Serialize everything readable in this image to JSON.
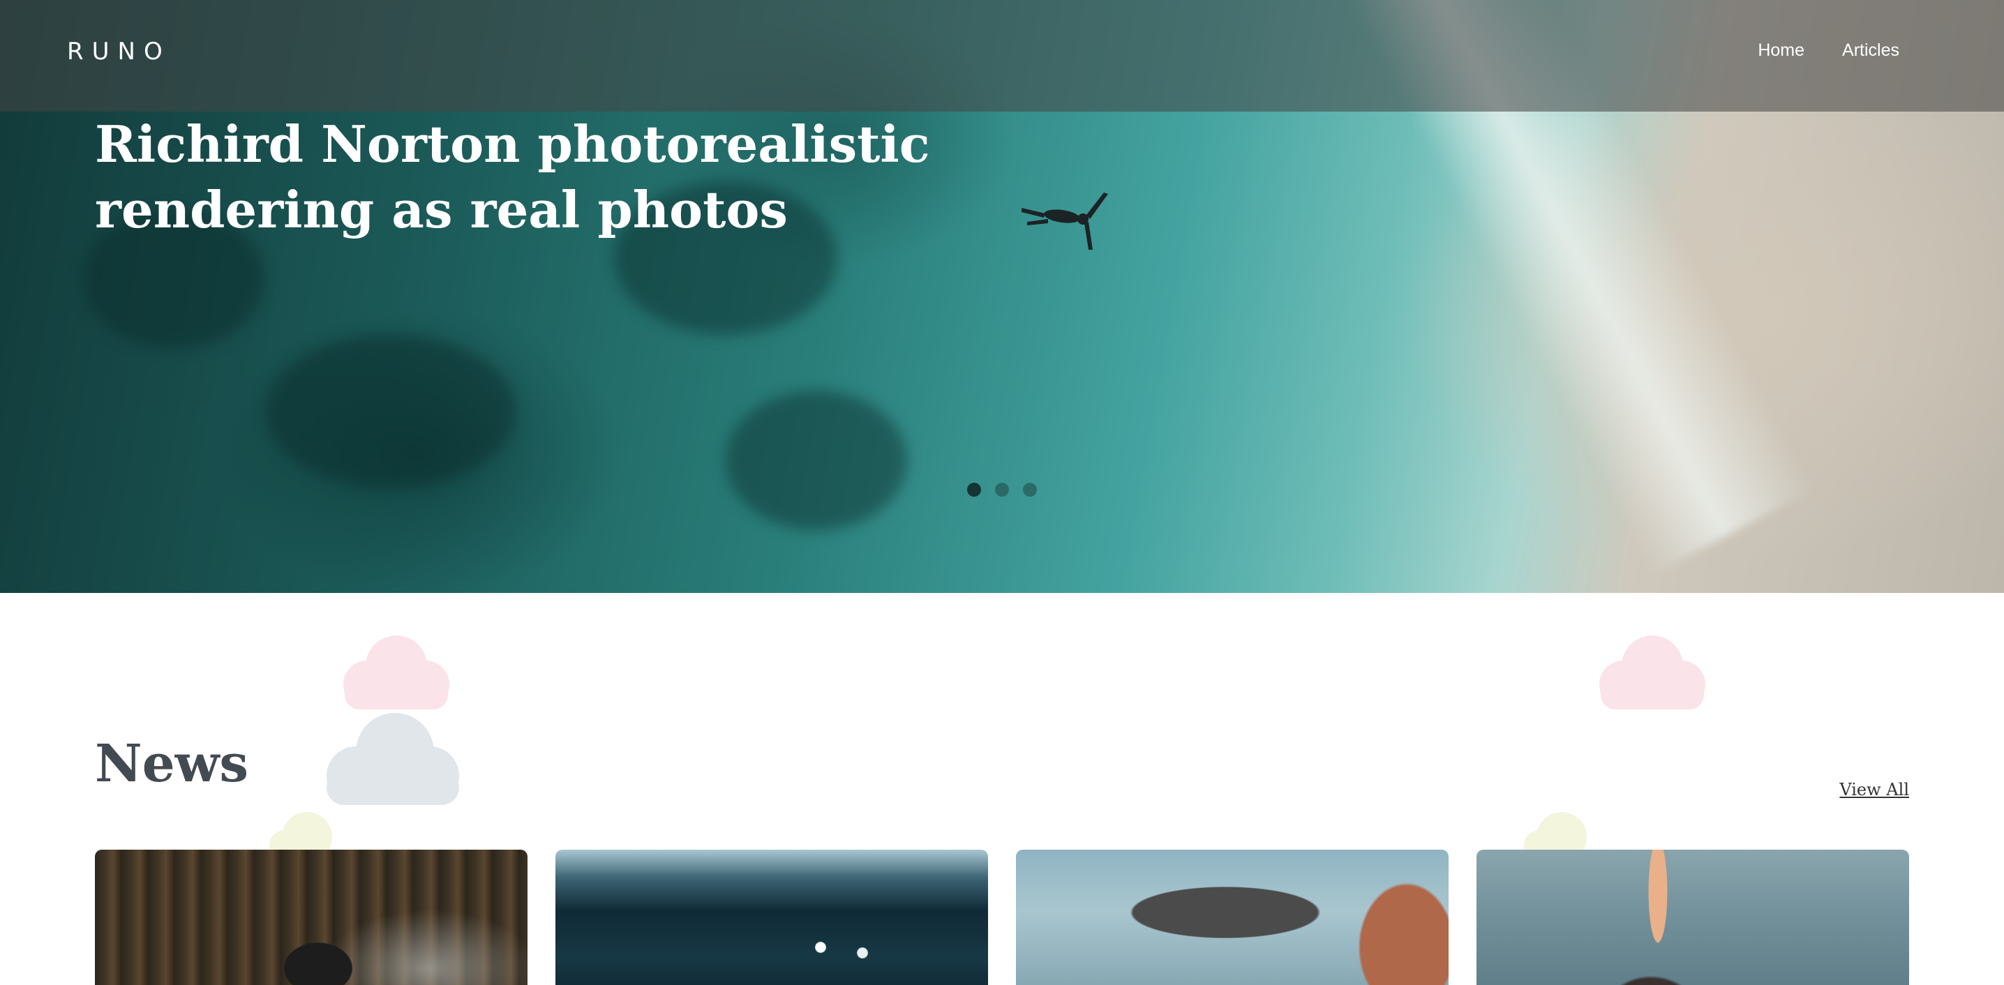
{
  "header": {
    "logo": "RUNO",
    "nav": [
      {
        "label": "Home"
      },
      {
        "label": "Articles"
      }
    ]
  },
  "hero": {
    "title_line1": "Richird Norton photorealistic",
    "title_line2": "rendering as real photos",
    "slides_count": 3,
    "active_slide": 1
  },
  "news": {
    "title": "News",
    "view_all": "View All",
    "cards_count": 4
  },
  "colors": {
    "cloud_pink": "#fbe3ea",
    "cloud_gray": "#e1e6ea",
    "cloud_yellow": "#f3f5dc",
    "heading_text": "#444a52"
  }
}
